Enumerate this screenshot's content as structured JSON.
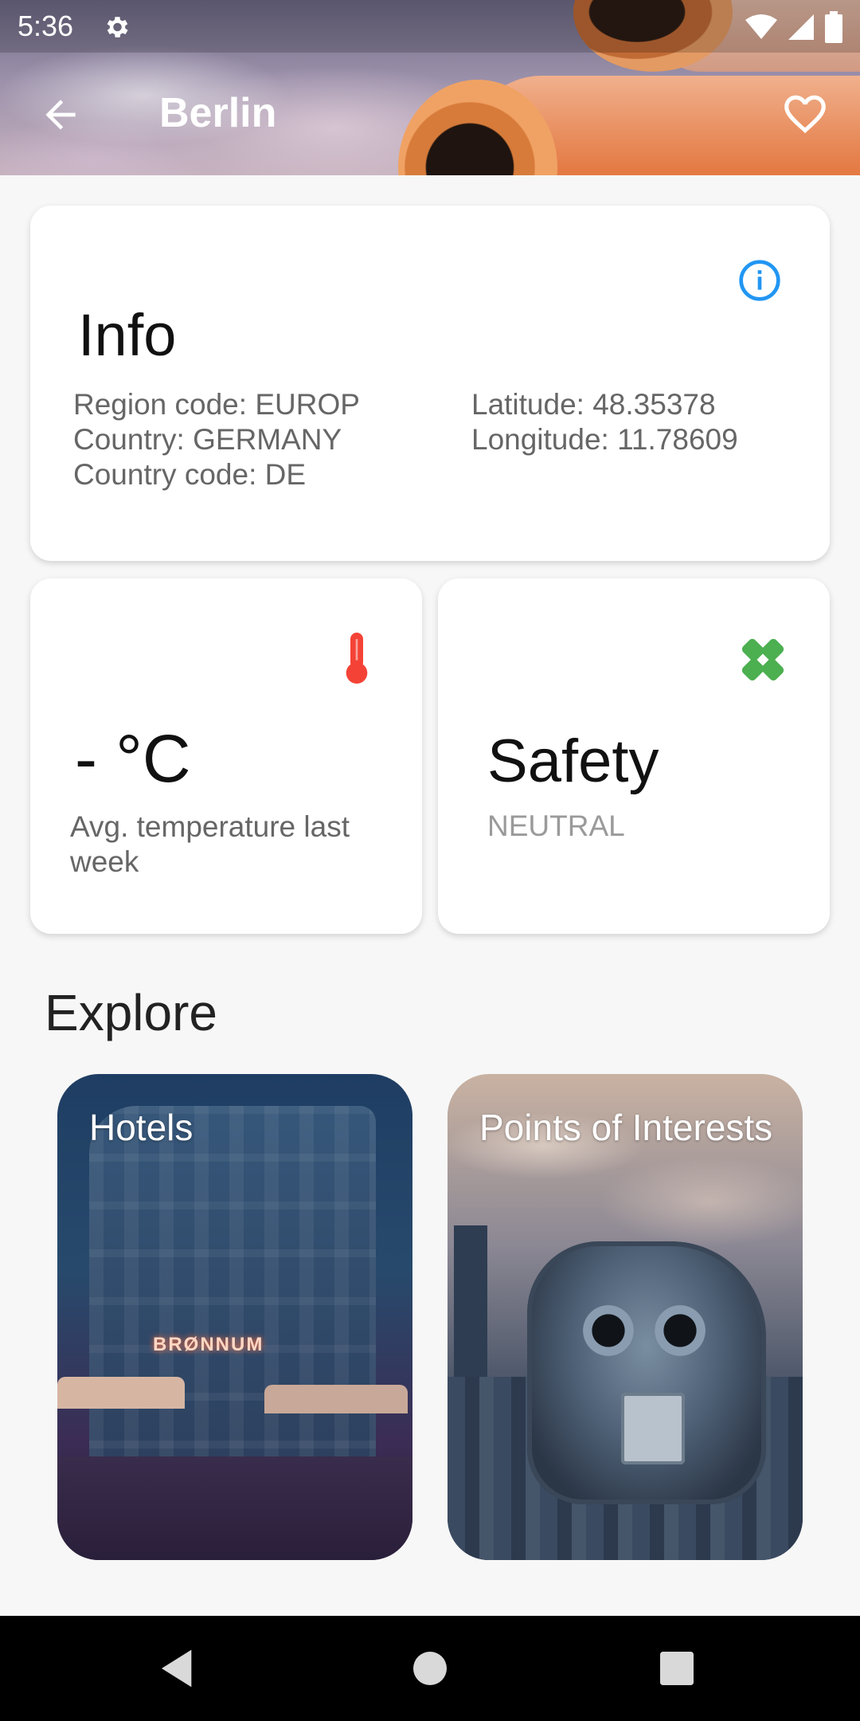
{
  "status_bar": {
    "time": "5:36",
    "icons": [
      "settings-gear-icon",
      "wifi-icon",
      "signal-icon",
      "battery-icon"
    ]
  },
  "header": {
    "title": "Berlin",
    "back_icon": "arrow-back-icon",
    "favorite_icon": "heart-outline-icon"
  },
  "info_card": {
    "title": "Info",
    "icon": "info-circle-icon",
    "left_details": [
      "Region code: EUROP",
      "Country: GERMANY",
      "Country code: DE"
    ],
    "right_details": [
      "Latitude: 48.35378",
      "Longitude: 11.78609"
    ]
  },
  "temperature_card": {
    "value": "- °C",
    "label": "Avg. temperature last week",
    "icon": "thermometer-icon"
  },
  "safety_card": {
    "title": "Safety",
    "status": "NEUTRAL",
    "icon": "bandage-icon"
  },
  "explore": {
    "title": "Explore",
    "tiles": [
      {
        "label": "Hotels",
        "sign_text": "BRØNNUM"
      },
      {
        "label": "Points of Interests"
      }
    ]
  },
  "nav_bar": {
    "buttons": [
      "back-triangle-icon",
      "home-circle-icon",
      "recents-square-icon"
    ]
  },
  "colors": {
    "info_icon": "#2196f3",
    "thermometer": "#f44336",
    "bandage": "#4caf50",
    "card_bg": "#ffffff",
    "page_bg": "#f7f7f7"
  }
}
